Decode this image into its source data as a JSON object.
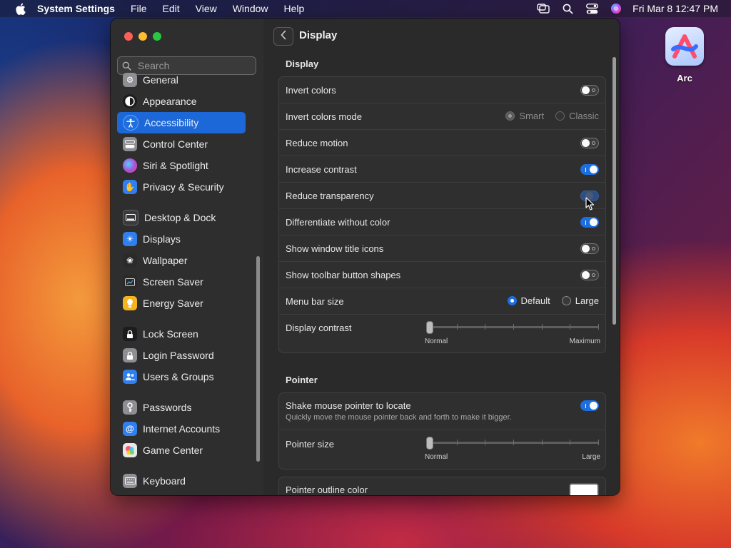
{
  "menubar": {
    "app_name": "System Settings",
    "menus": [
      "File",
      "Edit",
      "View",
      "Window",
      "Help"
    ],
    "clock": "Fri Mar 8  12:47 PM",
    "status_icons": [
      "stage-manager-icon",
      "spotlight-icon",
      "control-center-icon",
      "siri-icon"
    ]
  },
  "desktop": {
    "icons": [
      {
        "label": "Arc",
        "icon": "arc-app-icon"
      }
    ]
  },
  "sidebar": {
    "search_placeholder": "Search",
    "items": [
      {
        "label": "General",
        "icon": "gear-icon",
        "color": "#8e8e93"
      },
      {
        "label": "Appearance",
        "icon": "appearance-icon",
        "color": "#1c1c1e"
      },
      {
        "label": "Accessibility",
        "icon": "accessibility-icon",
        "color": "#1d6fe0",
        "active": true
      },
      {
        "label": "Control Center",
        "icon": "control-center-icon",
        "color": "#8e8e93"
      },
      {
        "label": "Siri & Spotlight",
        "icon": "siri-icon",
        "color": "#b04bd8"
      },
      {
        "label": "Privacy & Security",
        "icon": "hand-icon",
        "color": "#2f7ff0"
      },
      {
        "label": "Desktop & Dock",
        "icon": "dock-icon",
        "color": "#3a3a3c"
      },
      {
        "label": "Displays",
        "icon": "sun-icon",
        "color": "#2f7ff0"
      },
      {
        "label": "Wallpaper",
        "icon": "flower-icon",
        "color": "#4aa0e8"
      },
      {
        "label": "Screen Saver",
        "icon": "screen-saver-icon",
        "color": "#5ac8e8"
      },
      {
        "label": "Energy Saver",
        "icon": "lightbulb-icon",
        "color": "#f5b31c"
      },
      {
        "label": "Lock Screen",
        "icon": "lock-icon",
        "color": "#1c1c1e"
      },
      {
        "label": "Login Password",
        "icon": "lock-icon",
        "color": "#8e8e93"
      },
      {
        "label": "Users & Groups",
        "icon": "users-icon",
        "color": "#2f7ff0"
      },
      {
        "label": "Passwords",
        "icon": "key-icon",
        "color": "#8e8e93"
      },
      {
        "label": "Internet Accounts",
        "icon": "at-icon",
        "color": "#2f7ff0"
      },
      {
        "label": "Game Center",
        "icon": "game-center-icon",
        "color": "#e8e8e8"
      },
      {
        "label": "Keyboard",
        "icon": "keyboard-icon",
        "color": "#8e8e93"
      }
    ]
  },
  "content": {
    "title": "Display",
    "display_section": {
      "heading": "Display",
      "invert_colors": {
        "label": "Invert colors",
        "on": false
      },
      "invert_colors_mode": {
        "label": "Invert colors mode",
        "options": [
          "Smart",
          "Classic"
        ],
        "selected": "Smart",
        "enabled": false
      },
      "reduce_motion": {
        "label": "Reduce motion",
        "on": false
      },
      "increase_contrast": {
        "label": "Increase contrast",
        "on": true
      },
      "reduce_transparency": {
        "label": "Reduce transparency",
        "on": true,
        "transitioning": true
      },
      "differentiate_without_color": {
        "label": "Differentiate without color",
        "on": true
      },
      "show_window_title_icons": {
        "label": "Show window title icons",
        "on": false
      },
      "show_toolbar_button_shapes": {
        "label": "Show toolbar button shapes",
        "on": false
      },
      "menu_bar_size": {
        "label": "Menu bar size",
        "options": [
          "Default",
          "Large"
        ],
        "selected": "Default"
      },
      "display_contrast": {
        "label": "Display contrast",
        "min_label": "Normal",
        "max_label": "Maximum",
        "value": 0
      }
    },
    "pointer_section": {
      "heading": "Pointer",
      "shake_to_locate": {
        "label": "Shake mouse pointer to locate",
        "description": "Quickly move the mouse pointer back and forth to make it bigger.",
        "on": true
      },
      "pointer_size": {
        "label": "Pointer size",
        "min_label": "Normal",
        "max_label": "Large",
        "value": 0
      },
      "pointer_outline_color": {
        "label": "Pointer outline color",
        "color": "#ffffff"
      }
    }
  }
}
